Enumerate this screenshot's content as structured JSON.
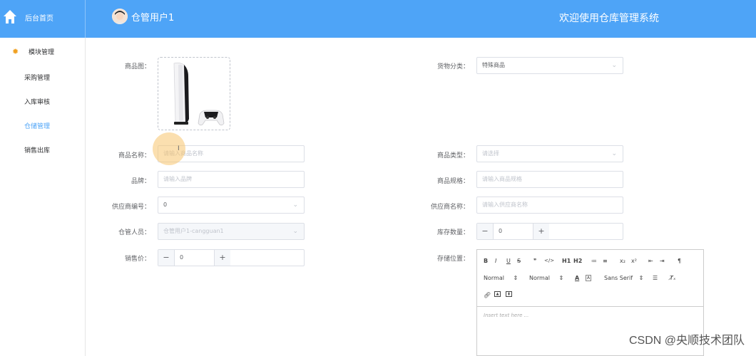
{
  "header": {
    "home_label": "后台首页",
    "user_name": "仓管用户1",
    "welcome": "欢迎使用仓库管理系统"
  },
  "sidebar": {
    "group_label": "模块管理",
    "items": [
      {
        "label": "采购管理",
        "active": false
      },
      {
        "label": "入库审核",
        "active": false
      },
      {
        "label": "仓储管理",
        "active": true
      },
      {
        "label": "销售出库",
        "active": false
      }
    ]
  },
  "form": {
    "image_label": "商品图：",
    "category_label": "货物分类：",
    "category_value": "特殊商品",
    "name_label": "商品名称：",
    "name_placeholder": "请输入商品名称",
    "type_label": "商品类型：",
    "type_placeholder": "请选择",
    "brand_label": "品牌：",
    "brand_placeholder": "请输入品牌",
    "spec_label": "商品规格：",
    "spec_placeholder": "请输入商品规格",
    "supplier_no_label": "供应商编号：",
    "supplier_no_value": "0",
    "supplier_name_label": "供应商名称：",
    "supplier_name_placeholder": "请输入供应商名称",
    "keeper_label": "仓管人员：",
    "keeper_value": "仓管用户1-cangguan1",
    "stock_label": "库存数量：",
    "stock_value": "0",
    "price_label": "销售价：",
    "price_value": "0",
    "location_label": "存储位置："
  },
  "editor": {
    "toolbar_row1": [
      "B",
      "I",
      "U",
      "S",
      "❞",
      "</>",
      "H1",
      "H2",
      "≔",
      "≡",
      "x₂",
      "x²",
      "⇤",
      "⇥",
      "¶"
    ],
    "header_select": "Normal",
    "size_select": "Normal",
    "font_select": "Sans Serif",
    "placeholder": "Insert text here ..."
  },
  "watermark": "CSDN @央顺技术团队"
}
